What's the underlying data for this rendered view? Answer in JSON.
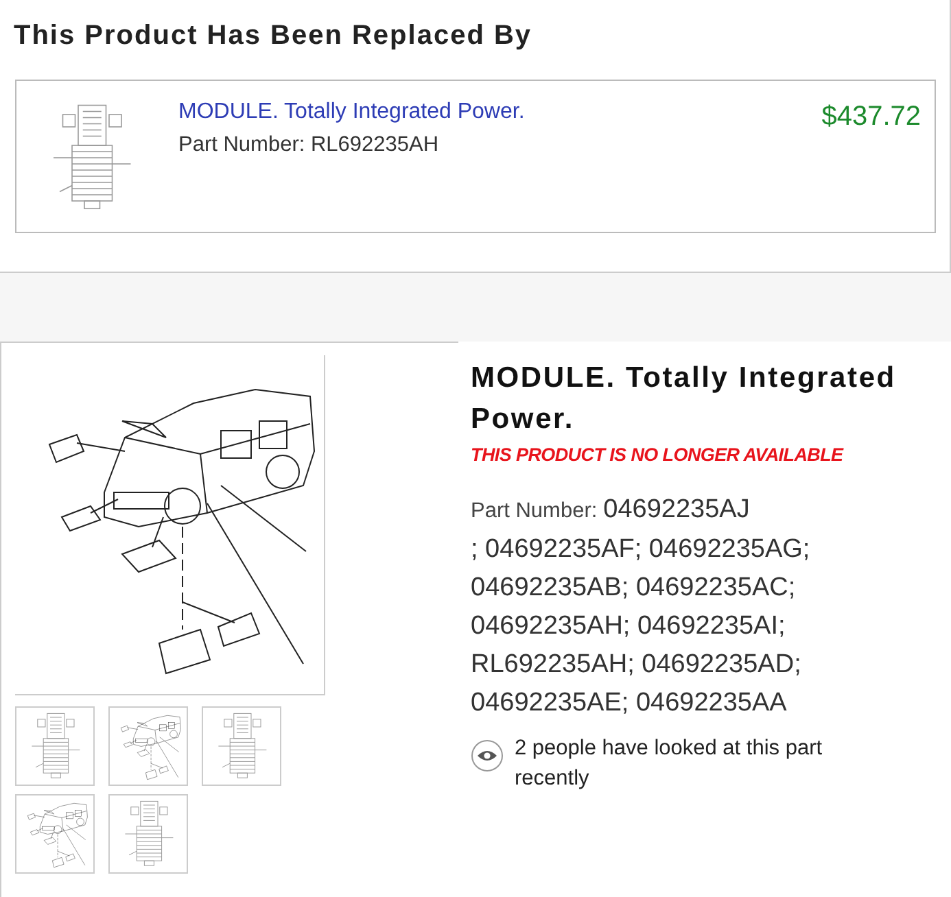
{
  "replacement": {
    "heading": "This Product Has Been Replaced By",
    "product": {
      "title": "MODULE. Totally Integrated Power.",
      "part_number": "Part Number: RL692235AH",
      "price": "$437.72"
    }
  },
  "product": {
    "title": "MODULE. Totally Integrated Power.",
    "availability": "THIS PRODUCT IS NO LONGER AVAILABLE",
    "part_number": {
      "label": "Part Number:",
      "value": "04692235AJ",
      "continued": "; 04692235AF; 04692235AG; 04692235AB; 04692235AC; 04692235AH; 04692235AI; RL692235AH; 04692235AD; 04692235AE; 04692235AA"
    },
    "views": "2 people have looked at this part recently",
    "thumbnails": [
      {
        "kind": "fusebox",
        "selected": false
      },
      {
        "kind": "vehicle",
        "selected": false
      },
      {
        "kind": "fusebox",
        "selected": false
      },
      {
        "kind": "vehicle",
        "selected": false
      },
      {
        "kind": "fusebox",
        "selected": false
      }
    ]
  }
}
